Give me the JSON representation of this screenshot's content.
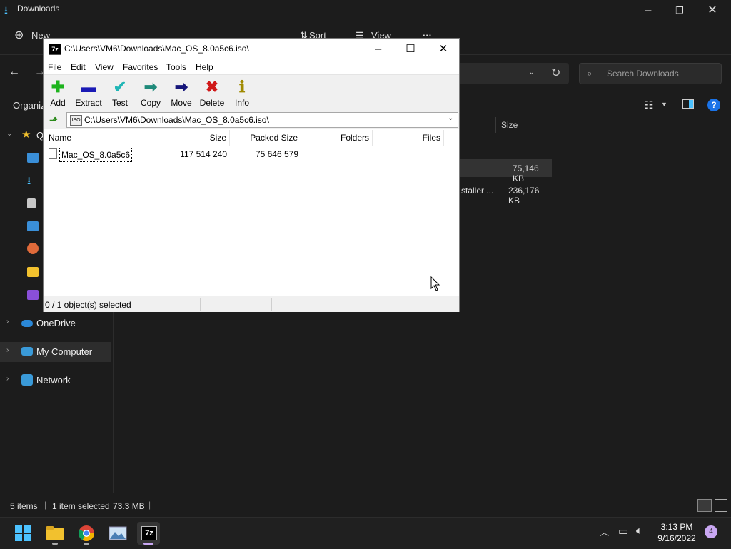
{
  "explorer": {
    "title": "Downloads",
    "toolbar": {
      "new": "New",
      "sort": "Sort",
      "view": "View",
      "more": "···"
    },
    "organize": "Organiz",
    "search_placeholder": "Search Downloads",
    "column_size": "Size",
    "rows": [
      {
        "name_fragment": "",
        "size": "75,146 KB"
      },
      {
        "name_fragment": "staller ...",
        "size": "236,176 KB"
      }
    ],
    "sidebar": {
      "quick_access_label": "Q",
      "onedrive": "OneDrive",
      "my_computer": "My Computer",
      "network": "Network"
    },
    "status": {
      "items": "5 items",
      "selected": "1 item selected",
      "size": "73.3 MB"
    }
  },
  "sevenzip": {
    "app_icon": "7z",
    "title": "C:\\Users\\VM6\\Downloads\\Mac_OS_8.0a5c6.iso\\",
    "menu": [
      "File",
      "Edit",
      "View",
      "Favorites",
      "Tools",
      "Help"
    ],
    "tools": [
      {
        "label": "Add",
        "icon": "add-icon",
        "glyph": "✚",
        "color": "#1db31d"
      },
      {
        "label": "Extract",
        "icon": "extract-icon",
        "glyph": "▬",
        "color": "#1a1ab5"
      },
      {
        "label": "Test",
        "icon": "test-icon",
        "glyph": "✔",
        "color": "#20b6b6"
      },
      {
        "label": "Copy",
        "icon": "copy-icon",
        "glyph": "➡",
        "color": "#1f8a7a"
      },
      {
        "label": "Move",
        "icon": "move-icon",
        "glyph": "➡",
        "color": "#16167a"
      },
      {
        "label": "Delete",
        "icon": "delete-icon",
        "glyph": "✖",
        "color": "#d01818"
      },
      {
        "label": "Info",
        "icon": "info-icon",
        "glyph": "ℹ",
        "color": "#a08a00"
      }
    ],
    "path": "C:\\Users\\VM6\\Downloads\\Mac_OS_8.0a5c6.iso\\",
    "path_icon": "ISO",
    "columns": {
      "name": "Name",
      "size": "Size",
      "packed": "Packed Size",
      "folders": "Folders",
      "files": "Files"
    },
    "files": [
      {
        "name": "Mac_OS_8.0a5c6",
        "size": "117 514 240",
        "packed": "75 646 579"
      }
    ],
    "status": "0 / 1 object(s) selected"
  },
  "taskbar": {
    "time": "3:13 PM",
    "date": "9/16/2022",
    "notifications": "4",
    "sevenzip_label": "7z"
  }
}
